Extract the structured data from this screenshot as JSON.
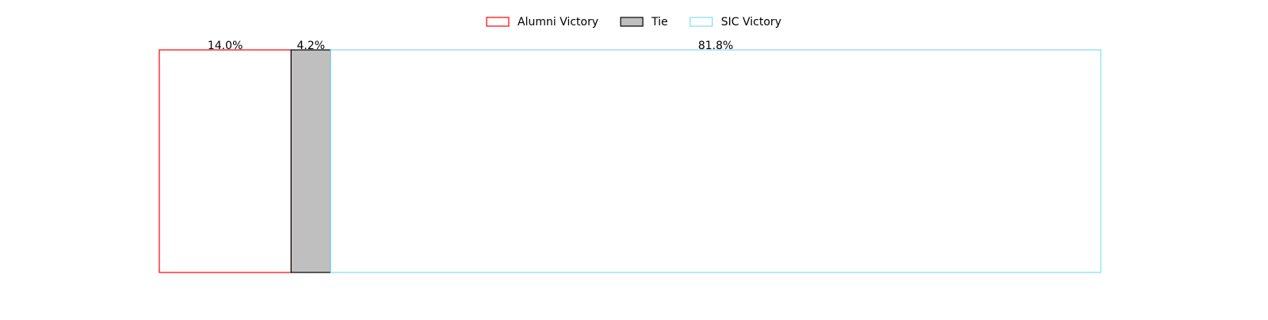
{
  "chart_data": {
    "type": "bar",
    "orientation": "horizontal-stacked",
    "legend_position": "top-center",
    "grid": false,
    "axes_visible": false,
    "xlim": [
      0,
      100
    ],
    "series": [
      {
        "name": "Alumni Victory",
        "value": 14.0,
        "label": "14.0%",
        "fill": "#ffffff",
        "edge": "#ff0000"
      },
      {
        "name": "Tie",
        "value": 4.2,
        "label": "4.2%",
        "fill": "#bfbfbf",
        "edge": "#000000"
      },
      {
        "name": "SIC Victory",
        "value": 81.8,
        "label": "81.8%",
        "fill": "#ffffff",
        "edge": "#7fdfef"
      }
    ]
  }
}
